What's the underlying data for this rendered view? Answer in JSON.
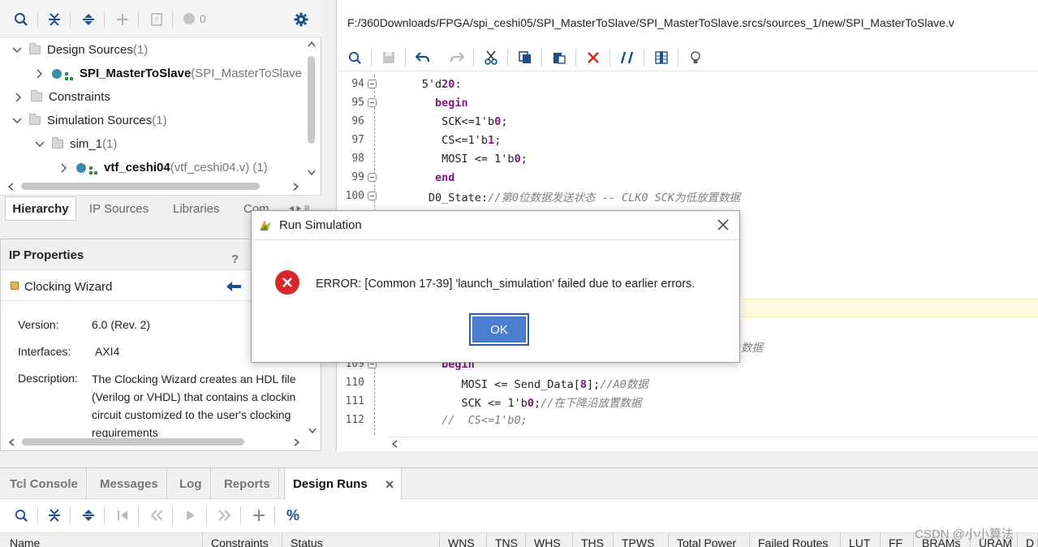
{
  "sources": {
    "toolbar": {
      "badge_count": "0"
    },
    "tree": [
      {
        "label": "Design Sources",
        "suffix": " (1)"
      },
      {
        "label": "SPI_MasterToSlave",
        "suffix": " (SPI_MasterToSlave"
      },
      {
        "label": "Constraints",
        "suffix": ""
      },
      {
        "label": "Simulation Sources",
        "suffix": " (1)"
      },
      {
        "label": "sim_1",
        "suffix": " (1)"
      },
      {
        "label": "vtf_ceshi04",
        "suffix": " (vtf_ceshi04.v) (1)"
      }
    ],
    "tabs": [
      "Hierarchy",
      "IP Sources",
      "Libraries",
      "Com"
    ]
  },
  "ip_properties": {
    "title": "IP Properties",
    "help": "?",
    "ip_name": "Clocking Wizard",
    "version_label": "Version:",
    "version_value": "6.0 (Rev. 2)",
    "interfaces_label": "Interfaces:",
    "interfaces_value": "AXI4",
    "description_label": "Description:",
    "description_lines": [
      "The Clocking Wizard creates an HDL file",
      "(Verilog or VHDL) that contains a clockin",
      "circuit customized to the user's clocking",
      "requirements"
    ]
  },
  "editor": {
    "file_path": "F:/360Downloads/FPGA/spi_ceshi05/SPI_MasterToSlave/SPI_MasterToSlave.srcs/sources_1/new/SPI_MasterToSlave.v",
    "lines": [
      {
        "n": "94",
        "indent": "      ",
        "parts": [
          [
            "n",
            "5'd"
          ],
          [
            "b",
            "20"
          ],
          [
            "n",
            ":"
          ]
        ]
      },
      {
        "n": "95",
        "indent": "        ",
        "parts": [
          [
            "k",
            "begin"
          ]
        ]
      },
      {
        "n": "96",
        "indent": "         ",
        "parts": [
          [
            "n",
            "SCK<=1'b"
          ],
          [
            "b",
            "0"
          ],
          [
            "n",
            ";"
          ]
        ]
      },
      {
        "n": "97",
        "indent": "         ",
        "parts": [
          [
            "n",
            "CS<=1'b"
          ],
          [
            "b",
            "1"
          ],
          [
            "n",
            ";"
          ]
        ]
      },
      {
        "n": "98",
        "indent": "         ",
        "parts": [
          [
            "n",
            "MOSI <= 1'b"
          ],
          [
            "b",
            "0"
          ],
          [
            "n",
            ";"
          ]
        ]
      },
      {
        "n": "99",
        "indent": "        ",
        "parts": [
          [
            "k",
            "end"
          ]
        ]
      },
      {
        "n": "100",
        "indent": "       ",
        "parts": [
          [
            "n",
            "D0_State:"
          ],
          [
            "c",
            "//第0位数据发送状态 -- CLK0 SCK为低放置数据"
          ]
        ]
      },
      {
        "n": "109",
        "indent": "         ",
        "parts": [
          [
            "k",
            "begin"
          ]
        ]
      },
      {
        "n": "110",
        "indent": "            ",
        "parts": [
          [
            "n",
            "MOSI <= Send_Data["
          ],
          [
            "b",
            "8"
          ],
          [
            "n",
            "];"
          ],
          [
            "c",
            "//A0数据"
          ]
        ]
      },
      {
        "n": "111",
        "indent": "            ",
        "parts": [
          [
            "n",
            "SCK <= 1'b"
          ],
          [
            "b",
            "0"
          ],
          [
            "n",
            ";"
          ],
          [
            "c",
            "//在下降沿放置数据"
          ]
        ]
      },
      {
        "n": "112",
        "indent": "         ",
        "parts": [
          [
            "c",
            "//  CS<=1'b0;"
          ]
        ]
      }
    ],
    "partial_comment": "数据"
  },
  "dialog": {
    "title": "Run Simulation",
    "message": "ERROR: [Common 17-39] 'launch_simulation' failed due to earlier errors.",
    "ok_label": "OK"
  },
  "bottom": {
    "tabs": [
      "Tcl Console",
      "Messages",
      "Log",
      "Reports",
      "Design Runs"
    ],
    "active_tab": "Design Runs",
    "toolbar_percent": "%",
    "columns": [
      "Name",
      "Constraints",
      "Status",
      "WNS",
      "TNS",
      "WHS",
      "THS",
      "TPWS",
      "Total Power",
      "Failed Routes",
      "LUT",
      "FF",
      "BRAMs",
      "URAM",
      "D"
    ]
  },
  "watermark": "CSDN @小小算法",
  "colors": {
    "accent": "#1f5fa8",
    "error": "#d9262b",
    "ok_button": "#4a7fd0",
    "highlight_line": "#fdfbe0"
  }
}
